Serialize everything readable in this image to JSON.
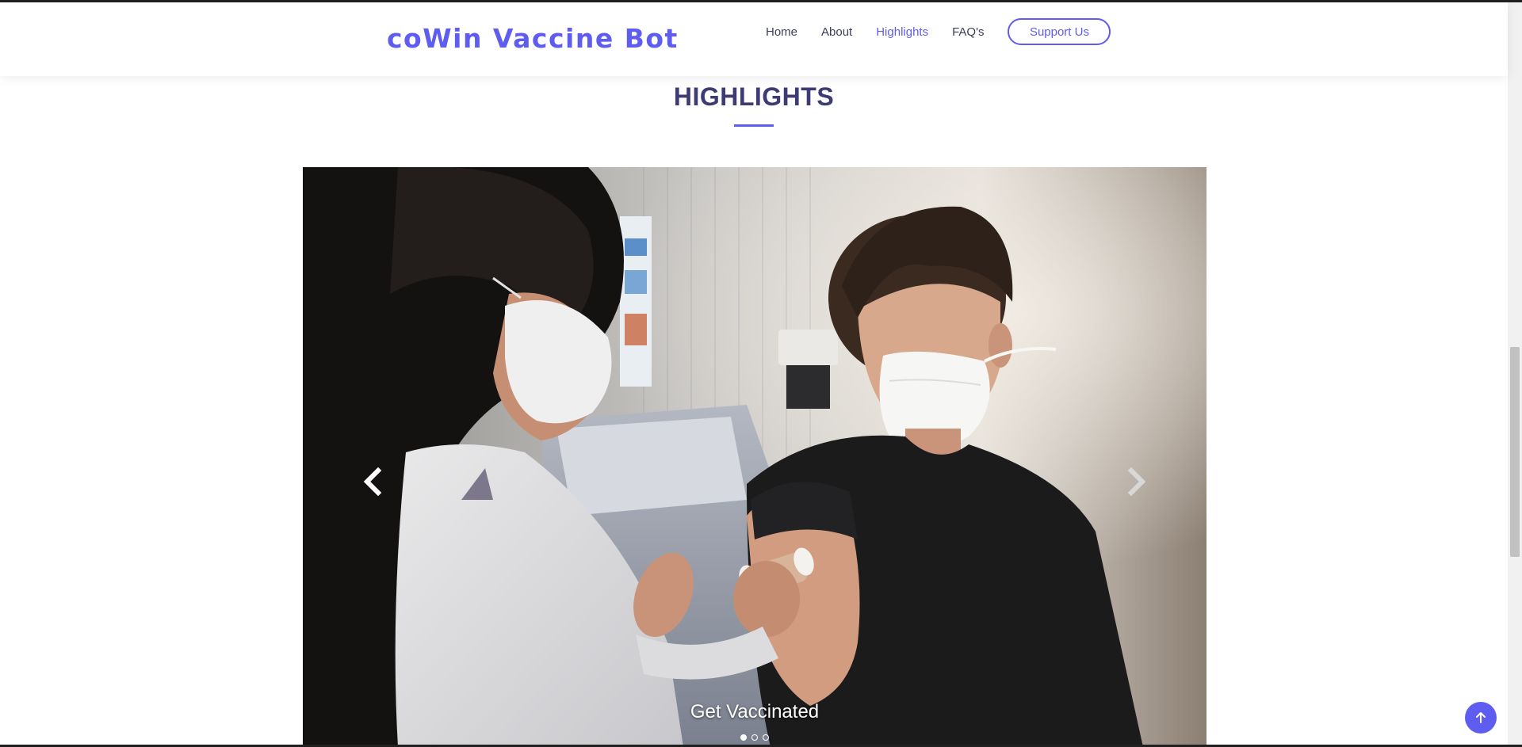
{
  "header": {
    "logo": "coWin Vaccine Bot",
    "nav": [
      {
        "label": "Home"
      },
      {
        "label": "About"
      },
      {
        "label": "Highlights"
      },
      {
        "label": "FAQ's"
      }
    ],
    "active_nav": "Highlights",
    "support_button": "Support Us"
  },
  "section": {
    "title": "HIGHLIGHTS"
  },
  "carousel": {
    "caption": "Get Vaccinated",
    "prev_icon": "chevron-left-icon",
    "next_icon": "chevron-right-icon",
    "slide_count": 3,
    "active_slide": 1
  },
  "back_to_top_icon": "arrow-up-icon",
  "colors": {
    "accent": "#5f5cf0",
    "heading": "#3d3b73",
    "nav_text": "#3b3f5c"
  }
}
